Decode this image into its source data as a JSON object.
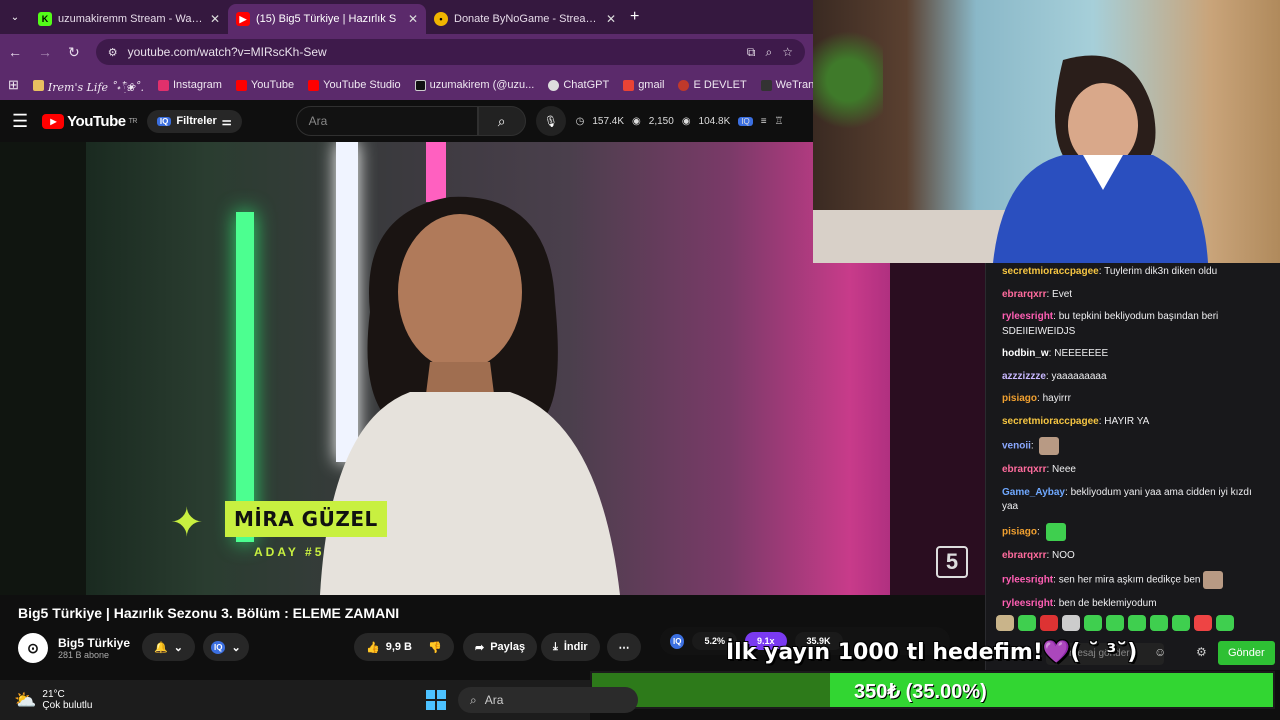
{
  "browser": {
    "tabs": [
      {
        "label": "uzumakiremm Stream - Watch (",
        "icon": "kick-icon",
        "color": "#53fc18"
      },
      {
        "label": "(15) Big5 Türkiye | Hazırlık S",
        "icon": "youtube-icon",
        "color": "#ff0000"
      },
      {
        "label": "Donate ByNoGame - Streamer",
        "icon": "bynogame-icon",
        "color": "#f0b400"
      }
    ],
    "url": "youtube.com/watch?v=MIRscKh-Sew",
    "bookmarks": [
      {
        "label": "Irem's Life ˚˖𓍢ִ໋❀˚.",
        "color": "#e8c060"
      },
      {
        "label": "Instagram",
        "color": "#e1306c"
      },
      {
        "label": "YouTube",
        "color": "#ff0000"
      },
      {
        "label": "YouTube Studio",
        "color": "#ff0000"
      },
      {
        "label": "uzumakirem (@uzu...",
        "color": "#111111"
      },
      {
        "label": "ChatGPT",
        "color": "#dddddd"
      },
      {
        "label": "gmail",
        "color": "#ea4335"
      },
      {
        "label": "E DEVLET",
        "color": "#c0392b"
      },
      {
        "label": "WeTransfe",
        "color": "#333333"
      }
    ]
  },
  "youtube": {
    "logo": "YouTube",
    "region": "TR",
    "filter_label": "Filtreler",
    "search_placeholder": "Ara",
    "stats": {
      "views": "157.4K",
      "second": "2,150",
      "third": "104.8K"
    }
  },
  "video": {
    "contestant_name": "MİRA GÜZEL",
    "contestant_tag": "ADAY #5",
    "channel_logo": "5",
    "title": "Big5 Türkiye | Hazırlık Sezonu 3. Bölüm : ELEME ZAMANI",
    "channel": "Big5 Türkiye",
    "subscribers": "281 B abone",
    "likes": "9,9 B",
    "share_label": "Paylaş",
    "download_label": "İndir"
  },
  "overlay_stats": {
    "a": "5.2%",
    "b": "9.1x",
    "c": "35.9K"
  },
  "chat": {
    "messages": [
      {
        "user": "secretmioraccpagee",
        "color": "#f5c542",
        "text": "Tuylerim dik3n diken oldu"
      },
      {
        "user": "ebrarqxrr",
        "color": "#ff6b9d",
        "text": "Evet"
      },
      {
        "user": "ryleesright",
        "color": "#ff5fb4",
        "text": "bu tepkini bekliyodum başından beri SDEIIEIWEIDJS"
      },
      {
        "user": "hodbin_w",
        "color": "#ffffff",
        "text": "NEEEEEEE"
      },
      {
        "user": "azzzizzze",
        "color": "#c8b8ff",
        "text": "yaaaaaaaaa"
      },
      {
        "user": "pisiago",
        "color": "#f0a030",
        "text": "hayirrr"
      },
      {
        "user": "secretmioraccpagee",
        "color": "#f5c542",
        "text": "HAYIR YA"
      },
      {
        "user": "venoii",
        "color": "#8aa8ff",
        "text": ""
      },
      {
        "user": "ebrarqxrr",
        "color": "#ff6b9d",
        "text": "Neee"
      },
      {
        "user": "Game_Aybay",
        "color": "#6fa8ff",
        "text": "bekliyodum yani yaa ama cidden iyi kızdı yaa"
      },
      {
        "user": "pisiago",
        "color": "#f0a030",
        "text": ""
      },
      {
        "user": "ebrarqxrr",
        "color": "#ff6b9d",
        "text": "NOO"
      },
      {
        "user": "ryleesright",
        "color": "#ff5fb4",
        "text": "sen her mira aşkım dedikçe ben"
      },
      {
        "user": "ryleesright",
        "color": "#ff5fb4",
        "text": "ben de beklemiyodum"
      }
    ],
    "input_placeholder": "Bir mesaj gönderin",
    "send_label": "Gönder"
  },
  "donation": {
    "goal_text": "İlk yayın 1000 tl hedefim!💜( ˘ ³˘)",
    "progress_label": "350₺ (35.00%)",
    "progress_fraction": 0.35
  },
  "taskbar": {
    "temperature": "21°C",
    "weather": "Çok bulutlu",
    "search": "Ara"
  }
}
